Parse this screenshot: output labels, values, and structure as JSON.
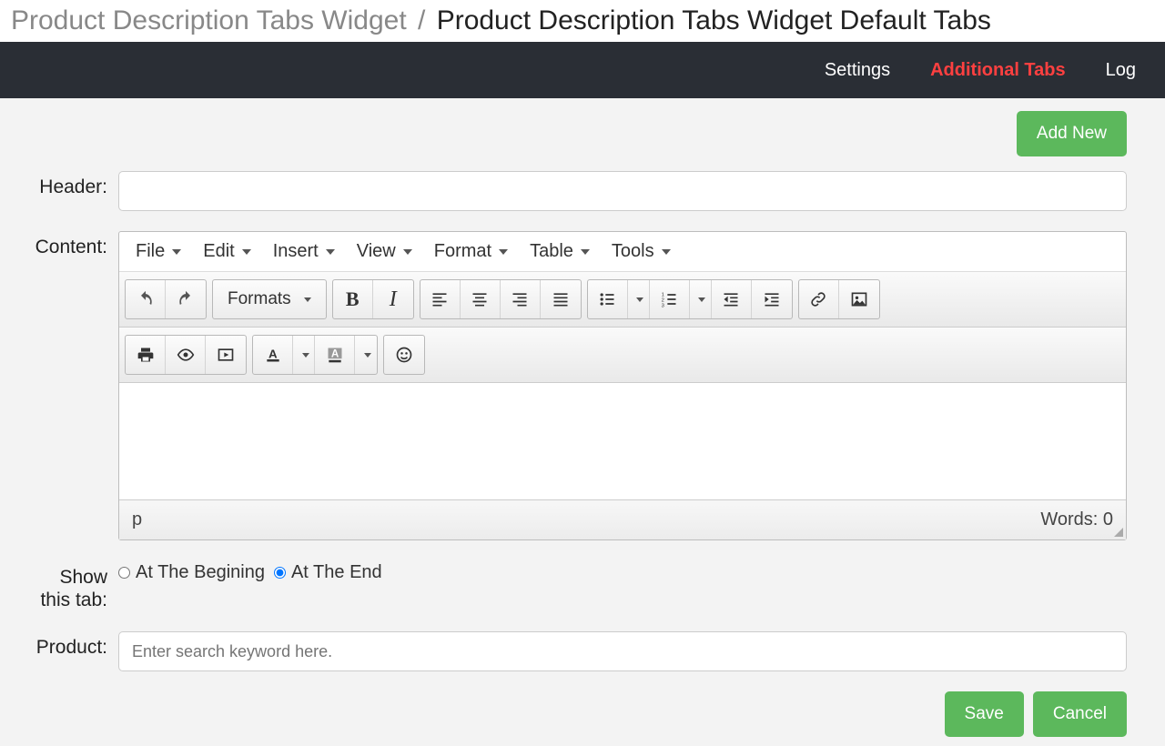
{
  "breadcrumb": {
    "parent": "Product Description Tabs Widget",
    "separator": "/",
    "current": "Product Description Tabs Widget Default Tabs"
  },
  "navbar": {
    "settings": "Settings",
    "additional_tabs": "Additional Tabs",
    "log": "Log"
  },
  "buttons": {
    "add_new": "Add New",
    "save": "Save",
    "cancel": "Cancel"
  },
  "labels": {
    "header": "Header:",
    "content": "Content:",
    "show_tab_line1": "Show",
    "show_tab_line2": "this tab:",
    "product": "Product:"
  },
  "editor": {
    "menubar": {
      "file": "File",
      "edit": "Edit",
      "insert": "Insert",
      "view": "View",
      "format": "Format",
      "table": "Table",
      "tools": "Tools"
    },
    "toolbar": {
      "formats": "Formats"
    },
    "statusbar": {
      "path": "p",
      "words": "Words: 0"
    }
  },
  "show_tab": {
    "beginning": "At The Begining",
    "end": "At The End",
    "selected": "end"
  },
  "product": {
    "placeholder": "Enter search keyword here."
  },
  "inputs": {
    "header_value": ""
  }
}
